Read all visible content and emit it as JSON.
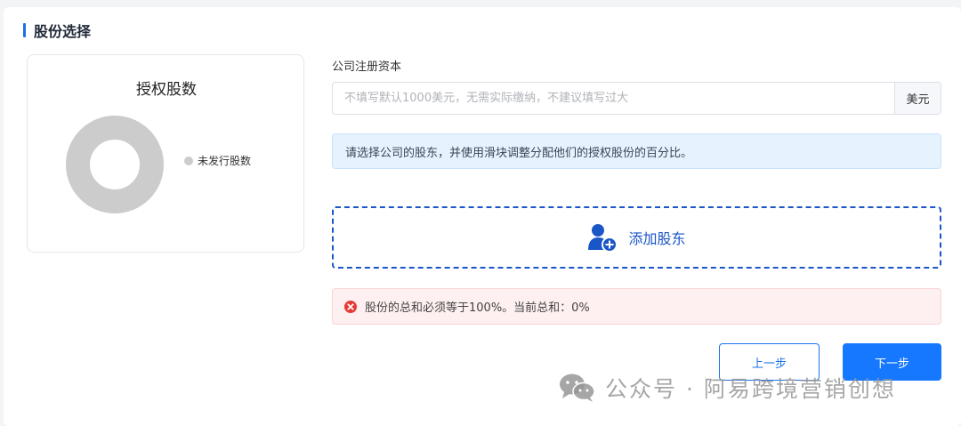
{
  "section": {
    "title": "股份选择"
  },
  "chart": {
    "title": "授权股数",
    "legend": [
      {
        "label": "未发行股数",
        "color": "#cccccc"
      }
    ]
  },
  "chart_data": {
    "type": "pie",
    "title": "授权股数",
    "categories": [
      "未发行股数"
    ],
    "values": [
      100
    ],
    "donut": true,
    "legend_position": "right"
  },
  "capital": {
    "label": "公司注册资本",
    "value": "",
    "placeholder": "不填写默认1000美元，无需实际缴纳，不建议填写过大",
    "suffix": "美元"
  },
  "info_alert": {
    "text": "请选择公司的股东，并使用滑块调整分配他们的授权股份的百分比。"
  },
  "add_shareholder": {
    "label": "添加股东",
    "color": "#1a56c8"
  },
  "error_alert": {
    "text": "股份的总和必须等于100%。当前总和：0%",
    "color": "#e53935"
  },
  "buttons": {
    "prev": "上一步",
    "next": "下一步"
  },
  "watermark": {
    "text": "公众号 · 阿易跨境营销创想"
  },
  "colors": {
    "accent": "#1677ff",
    "section_bar": "#1f6fe5",
    "donut": "#cccccc"
  }
}
